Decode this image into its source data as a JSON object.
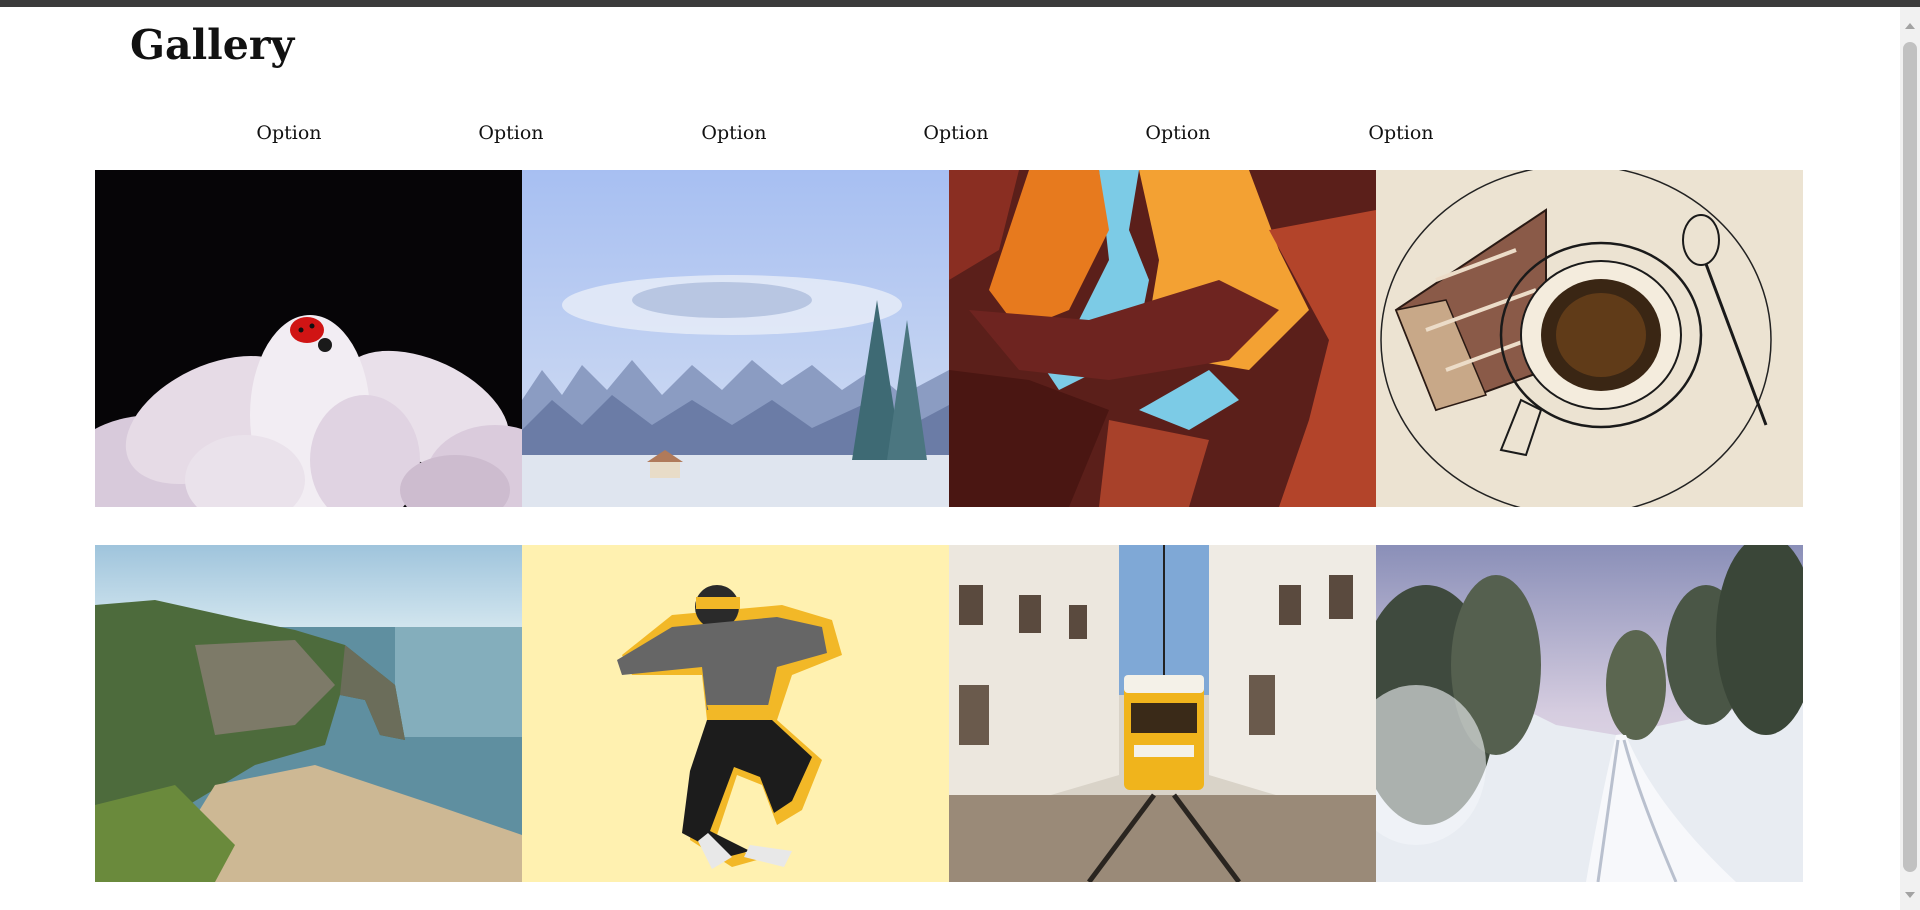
{
  "page": {
    "title": "Gallery"
  },
  "nav": {
    "items": [
      "Option",
      "Option",
      "Option",
      "Option",
      "Option",
      "Option"
    ]
  },
  "gallery": {
    "images": [
      {
        "name": "ladybug-on-flower-image"
      },
      {
        "name": "snowy-forest-cabin-image"
      },
      {
        "name": "canyon-rock-arch-image"
      },
      {
        "name": "cake-and-coffee-sketch-image"
      },
      {
        "name": "sea-arch-beach-image"
      },
      {
        "name": "dancing-man-illustration-image"
      },
      {
        "name": "yellow-tram-street-image"
      },
      {
        "name": "snowy-road-forest-image"
      }
    ]
  }
}
